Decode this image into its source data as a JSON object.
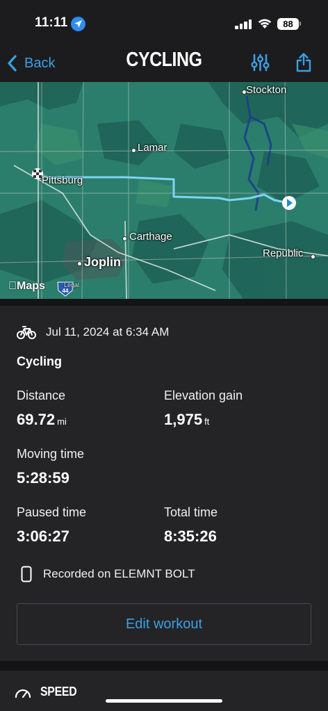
{
  "status_bar": {
    "time": "11:11",
    "battery": "88"
  },
  "nav": {
    "back_label": "Back",
    "title": "CYCLING"
  },
  "map": {
    "labels": {
      "stockton": "Stockton",
      "lamar": "Lamar",
      "pittsburg": "Pittsburg",
      "carthage": "Carthage",
      "joplin": "Joplin",
      "republic": "Republic"
    },
    "logo": "Maps",
    "legal": "Legal",
    "route_color": "#7fd4f5"
  },
  "workout": {
    "date": "Jul 11, 2024 at 6:34 AM",
    "type": "Cycling",
    "distance": {
      "label": "Distance",
      "value": "69.72",
      "unit": "mi"
    },
    "elevation": {
      "label": "Elevation gain",
      "value": "1,975",
      "unit": "ft"
    },
    "moving_time": {
      "label": "Moving time",
      "value": "5:28:59"
    },
    "paused_time": {
      "label": "Paused time",
      "value": "3:06:27"
    },
    "total_time": {
      "label": "Total time",
      "value": "8:35:26"
    },
    "recorded_on": "Recorded on ELEMNT BOLT",
    "edit_label": "Edit workout"
  },
  "speed": {
    "label": "SPEED"
  },
  "colors": {
    "accent": "#3aa0e6",
    "background": "#1c1c1e",
    "card": "#242426"
  }
}
